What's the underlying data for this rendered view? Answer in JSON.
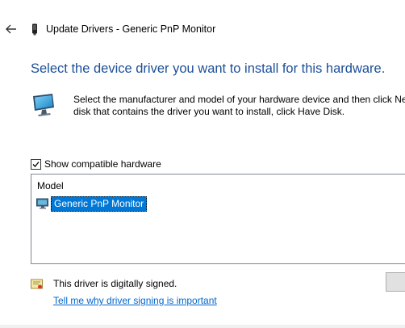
{
  "window": {
    "title": "Update Drivers - Generic PnP Monitor"
  },
  "heading": "Select the device driver you want to install for this hardware.",
  "intro": {
    "line1": "Select the manufacturer and model of your hardware device and then click Ne",
    "line2": "disk that contains the driver you want to install, click Have Disk."
  },
  "compatible_checkbox": {
    "label": "Show compatible hardware",
    "checked": true
  },
  "model_list": {
    "header": "Model",
    "items": [
      {
        "label": "Generic PnP Monitor",
        "selected": true
      }
    ]
  },
  "signing": {
    "status": "This driver is digitally signed.",
    "link": "Tell me why driver signing is important"
  },
  "colors": {
    "heading": "#1c4f99",
    "selection": "#0078d7",
    "link": "#0066cc"
  }
}
